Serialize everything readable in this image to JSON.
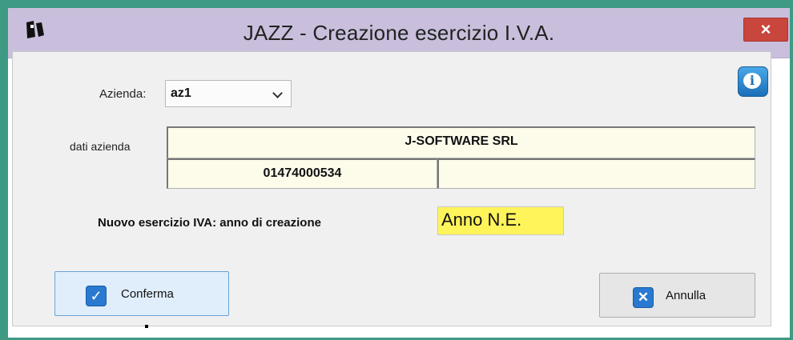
{
  "window": {
    "title": "JAZZ - Creazione esercizio I.V.A.",
    "close_label": "×",
    "app_icon": "jazz-logo-icon"
  },
  "form": {
    "azienda_label": "Azienda:",
    "azienda_value": "az1",
    "dati_label": "dati azienda",
    "company_name": "J-SOFTWARE SRL",
    "vat_number": "01474000534",
    "extra_field": "",
    "nuovo_label": "Nuovo esercizio IVA: anno di creazione",
    "anno_value": "Anno N.E."
  },
  "buttons": {
    "info_label": "i",
    "conferma": "Conferma",
    "annulla": "Annulla",
    "check_glyph": "✓",
    "x_glyph": "✕"
  },
  "colors": {
    "background": "#3f9a83",
    "titlebar": "#c9bfdc",
    "close": "#c9463d",
    "field_bg": "#fdfcea",
    "highlight": "#fff45a"
  }
}
